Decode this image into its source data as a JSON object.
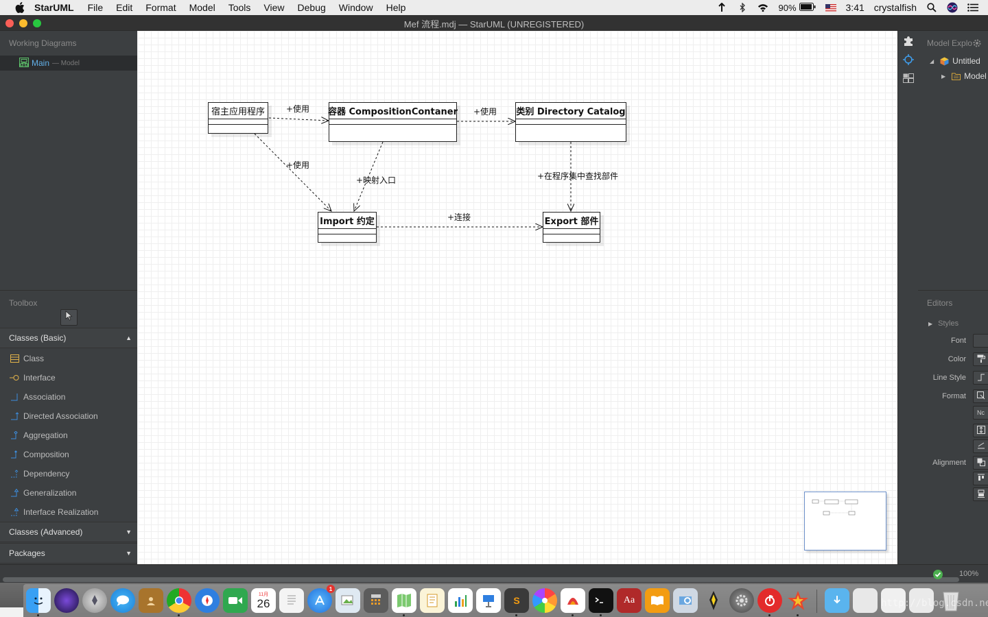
{
  "menubar": {
    "app_name": "StarUML",
    "items": [
      "File",
      "Edit",
      "Format",
      "Model",
      "Tools",
      "View",
      "Debug",
      "Window",
      "Help"
    ],
    "battery": "90%",
    "time": "3:41",
    "user": "crystalfish"
  },
  "window": {
    "title": "Mef 流程.mdj — StarUML (UNREGISTERED)",
    "colors": {
      "close": "#fc5f57",
      "minimize": "#fdbc2e",
      "zoom": "#28c840"
    }
  },
  "working_diagrams": {
    "header": "Working Diagrams",
    "item_name": "Main",
    "item_sub": "— Model"
  },
  "toolbox": {
    "header": "Toolbox",
    "sections": {
      "basic": "Classes (Basic)",
      "advanced": "Classes (Advanced)",
      "packages": "Packages"
    },
    "tools": [
      {
        "label": "Class",
        "icon": "class-icon"
      },
      {
        "label": "Interface",
        "icon": "interface-icon"
      },
      {
        "label": "Association",
        "icon": "association-icon"
      },
      {
        "label": "Directed Association",
        "icon": "directed-association-icon"
      },
      {
        "label": "Aggregation",
        "icon": "aggregation-icon"
      },
      {
        "label": "Composition",
        "icon": "composition-icon"
      },
      {
        "label": "Dependency",
        "icon": "dependency-icon"
      },
      {
        "label": "Generalization",
        "icon": "generalization-icon"
      },
      {
        "label": "Interface Realization",
        "icon": "interface-realization-icon"
      }
    ]
  },
  "diagram": {
    "classes": [
      {
        "id": "host",
        "name": "宿主应用程序"
      },
      {
        "id": "container",
        "name": "容器 CompositionContaner"
      },
      {
        "id": "catalog",
        "name": "类别  Directory Catalog"
      },
      {
        "id": "import",
        "name": "Import 约定"
      },
      {
        "id": "export",
        "name": "Export 部件"
      }
    ],
    "edges": [
      {
        "from": "host",
        "to": "container",
        "label": "+使用"
      },
      {
        "from": "container",
        "to": "catalog",
        "label": "+使用"
      },
      {
        "from": "host",
        "to": "import",
        "label": "+使用"
      },
      {
        "from": "container",
        "to": "import",
        "label": "+映射入口"
      },
      {
        "from": "catalog",
        "to": "export",
        "label": "+在程序集中查找部件"
      },
      {
        "from": "import",
        "to": "export",
        "label": "+连接"
      }
    ]
  },
  "model_explorer": {
    "header": "Model Explo",
    "items": [
      {
        "label": "Untitled",
        "expanded": true
      },
      {
        "label": "Model",
        "expanded": false
      }
    ]
  },
  "editors": {
    "header": "Editors",
    "styles_label": "Styles",
    "props": {
      "font": "Font",
      "color": "Color",
      "line_style": "Line Style",
      "format": "Format",
      "alignment": "Alignment"
    },
    "format_value": "Nc"
  },
  "status": {
    "zoom": "100%"
  },
  "dock": {
    "calendar_day": "26",
    "calendar_month": "11月",
    "appstore_badge": "1",
    "watermark": "http://blog.csdn.net/"
  }
}
